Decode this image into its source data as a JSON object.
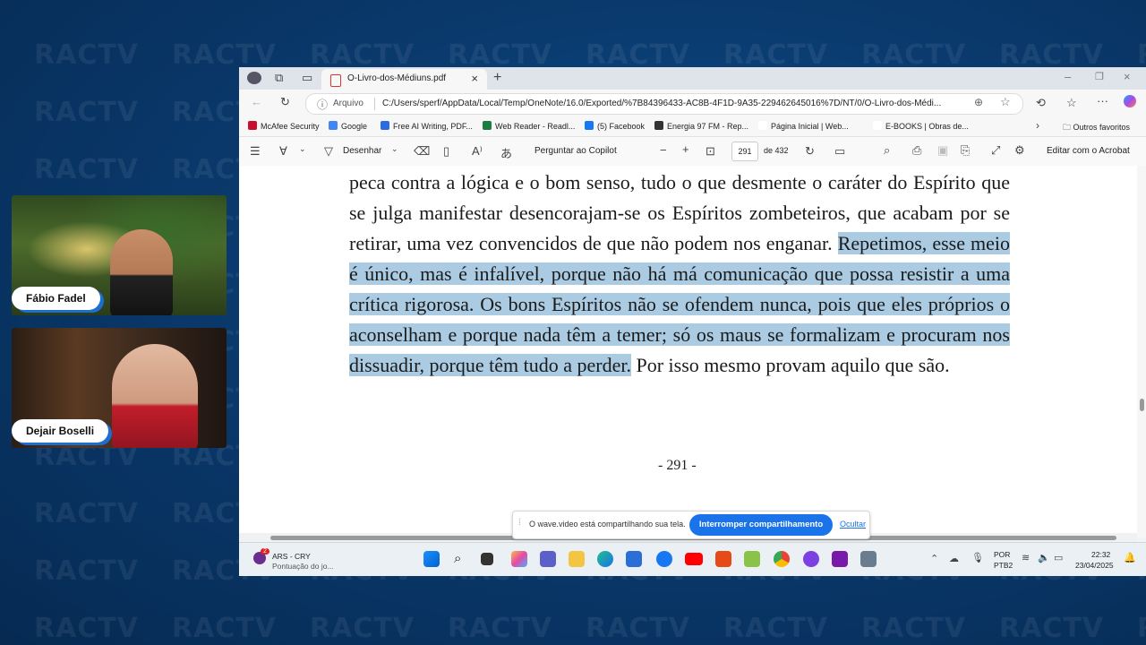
{
  "participants": [
    {
      "name": "Fábio Fadel"
    },
    {
      "name": "Dejair Boselli"
    }
  ],
  "browser": {
    "tab_title": "O-Livro-dos-Médiuns.pdf",
    "address_label": "Arquivo",
    "url": "C:/Users/sperf/AppData/Local/Temp/OneNote/16.0/Exported/%7B84396433-AC8B-4F1D-9A35-229462645016%7D/NT/0/O-Livro-dos-Médi...",
    "bookmarks": [
      {
        "label": "McAfee Security",
        "color": "#c8102e"
      },
      {
        "label": "Google",
        "color": "#4285f4"
      },
      {
        "label": "Free AI Writing, PDF...",
        "color": "#2b6de0"
      },
      {
        "label": "Web Reader - Readl...",
        "color": "#1d7d3f"
      },
      {
        "label": "(5) Facebook",
        "color": "#1877f2"
      },
      {
        "label": "Energia 97 FM - Rep...",
        "color": "#333333"
      },
      {
        "label": "Página Inicial | Web...",
        "color": "#ffffff"
      },
      {
        "label": "E-BOOKS | Obras de...",
        "color": "#ffffff"
      }
    ],
    "other_favorites": "Outros favoritos"
  },
  "pdf_toolbar": {
    "draw_label": "Desenhar",
    "copilot_label": "Perguntar ao Copilot",
    "page_current": "291",
    "page_total_label": "de 432",
    "acrobat_label": "Editar com o Acrobat"
  },
  "document": {
    "text_before": "peca contra a lógica e o bom senso, tudo o que desmente o caráter do Espírito que se julga manifestar desencorajam-se os Espíritos zombeteiros, que acabam por se retirar, uma vez convencidos de que não podem nos enganar. ",
    "text_highlighted": "Repetimos, esse meio é único, mas é infalível, porque não há má comunicação que possa resistir a uma crítica rigorosa. Os bons Espíritos não se ofendem nunca, pois que eles próprios o aconselham e porque nada têm a temer; só os maus se formalizam e procuram nos dissuadir, porque têm tudo a perder.",
    "text_after": " Por isso mesmo provam aquilo que são.",
    "page_number": "- 291 -",
    "highlight_color": "#aacbe2"
  },
  "share_banner": {
    "message": "O wave.video está compartilhando sua tela.",
    "stop_button": "Interromper compartilhamento",
    "hide_link": "Ocultar"
  },
  "taskbar": {
    "widget_title": "ARS - CRY",
    "widget_sub": "Pontuação do jo...",
    "widget_badge": "2",
    "lang_top": "POR",
    "lang_bottom": "PTB2",
    "time": "22:32",
    "date": "23/04/2025"
  },
  "watermark_text": "RACTV"
}
